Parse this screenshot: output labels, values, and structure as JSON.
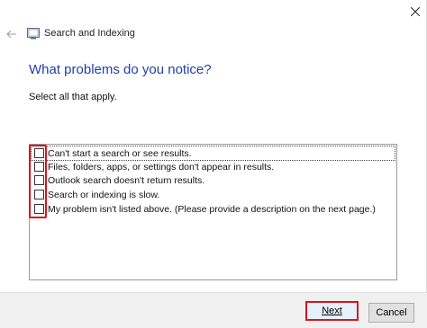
{
  "window": {
    "title": "Search and Indexing"
  },
  "page": {
    "heading": "What problems do you notice?",
    "instruction": "Select all that apply."
  },
  "options": [
    {
      "label": "Can't start a search or see results.",
      "checked": false
    },
    {
      "label": "Files, folders, apps, or settings don't appear in results.",
      "checked": false
    },
    {
      "label": "Outlook search doesn't return results.",
      "checked": false
    },
    {
      "label": "Search or indexing is slow.",
      "checked": false
    },
    {
      "label": "My problem isn't listed above. (Please provide a description on the next page.)",
      "checked": false
    }
  ],
  "buttons": {
    "next": "Next",
    "cancel": "Cancel"
  },
  "colors": {
    "heading": "#1f3fa6",
    "highlight": "#d9141b"
  }
}
